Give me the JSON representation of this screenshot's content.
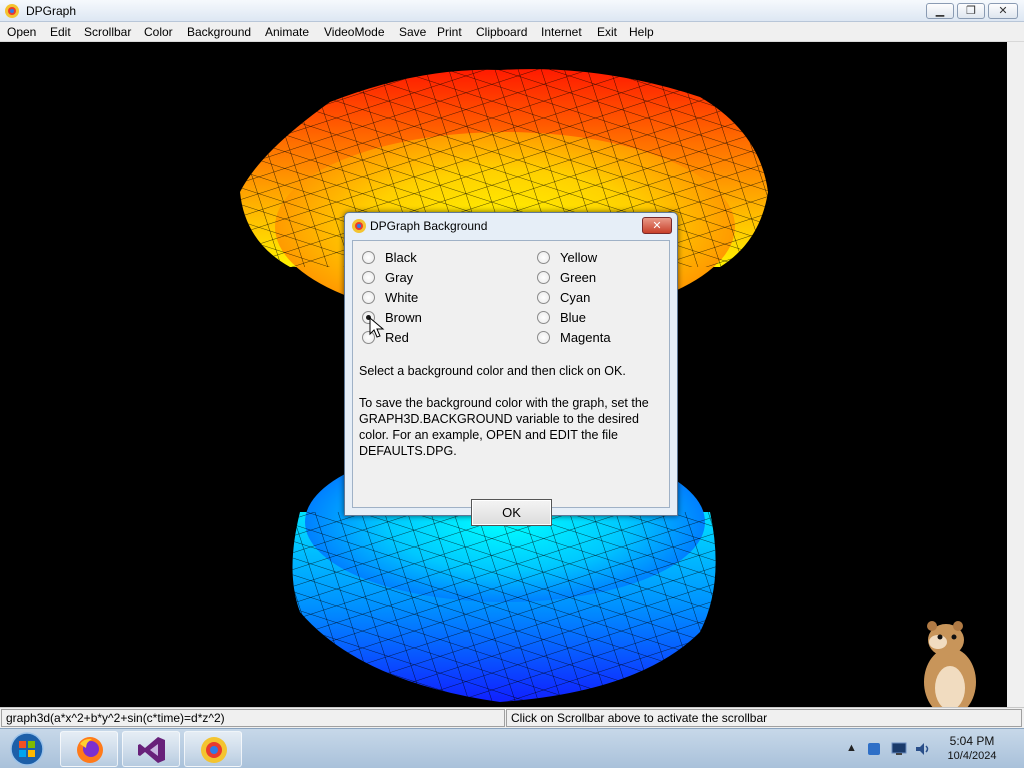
{
  "window": {
    "title": "DPGraph"
  },
  "menu": [
    "Open",
    "Edit",
    "Scrollbar",
    "Color",
    "Background",
    "Animate",
    "VideoMode",
    "Save",
    "Print",
    "Clipboard",
    "Internet",
    "Exit",
    "Help"
  ],
  "dialog": {
    "title": "DPGraph Background",
    "options_left": [
      "Black",
      "Gray",
      "White",
      "Brown",
      "Red"
    ],
    "options_right": [
      "Yellow",
      "Green",
      "Cyan",
      "Blue",
      "Magenta"
    ],
    "selected": "Brown",
    "instruction": "Select a background color and then click on OK.",
    "note": "To save the background color with the graph, set the GRAPH3D.BACKGROUND variable to the desired color.  For an example, OPEN and EDIT the file DEFAULTS.DPG.",
    "ok_label": "OK"
  },
  "status": {
    "left": "graph3d(a*x^2+b*y^2+sin(c*time)=d*z^2)",
    "right": "Click on Scrollbar above to activate the scrollbar"
  },
  "taskbar": {
    "pinned": [
      "firefox-icon",
      "visual-studio-icon",
      "dpgraph-icon"
    ],
    "tray": {
      "time": "5:04 PM",
      "date": "10/4/2024"
    }
  }
}
